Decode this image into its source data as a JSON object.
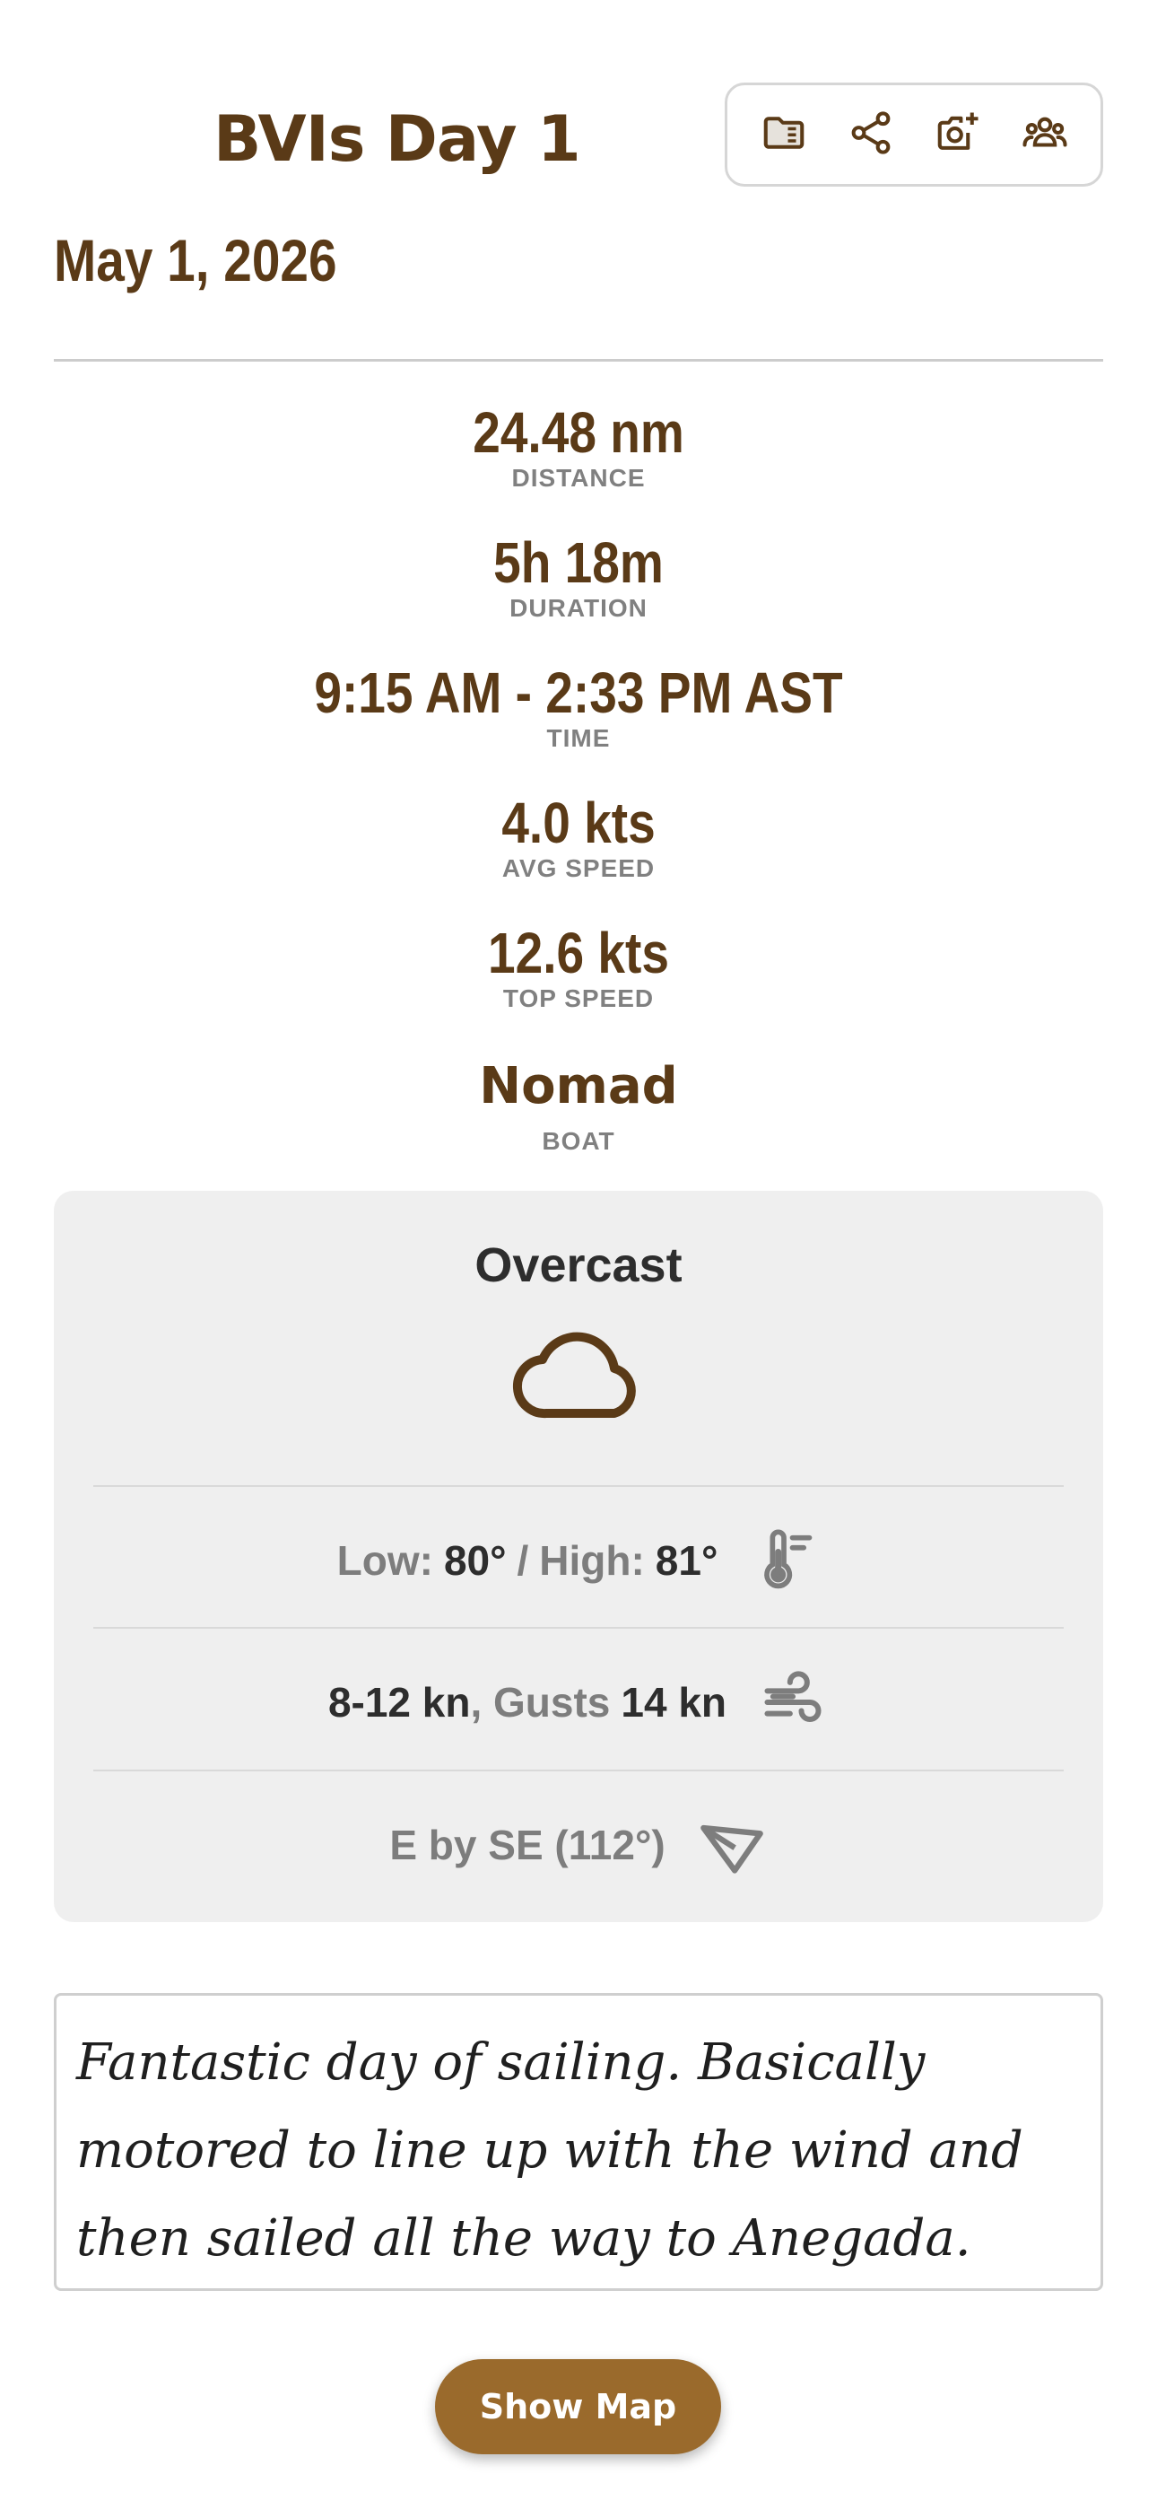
{
  "header": {
    "title": "BVIs Day 1",
    "date": "May 1, 2026"
  },
  "toolbar": {
    "buttons": [
      {
        "name": "folder",
        "icon": "folder-icon"
      },
      {
        "name": "share",
        "icon": "share-icon"
      },
      {
        "name": "add-photo",
        "icon": "add-photo-icon"
      },
      {
        "name": "crew",
        "icon": "people-icon"
      }
    ]
  },
  "stats": {
    "distance": {
      "value": "24.48 nm",
      "label": "DISTANCE"
    },
    "duration": {
      "value": "5h 18m",
      "label": "DURATION"
    },
    "time": {
      "value": "9:15 AM - 2:33 PM AST",
      "label": "TIME"
    },
    "avg_speed": {
      "value": "4.0 kts",
      "label": "AVG SPEED"
    },
    "top_speed": {
      "value": "12.6 kts",
      "label": "TOP SPEED"
    },
    "boat": {
      "value": "Nomad",
      "label": "BOAT"
    }
  },
  "weather": {
    "condition": "Overcast",
    "condition_icon": "cloud-icon",
    "temp": {
      "low_label": "Low:",
      "low_value": "80°",
      "separator": "/",
      "high_label": "High:",
      "high_value": "81°",
      "icon": "thermometer-icon"
    },
    "wind": {
      "range": "8-12 kn",
      "gusts_label": ", Gusts",
      "gusts_value": "14 kn",
      "icon": "wind-icon"
    },
    "direction": {
      "text": "E by SE (112°)",
      "icon": "direction-arrow-icon"
    }
  },
  "notes": {
    "text": "Fantastic day of sailing. Basically motored to line up with the wind and then sailed all the way to Anegada."
  },
  "actions": {
    "show_map_label": "Show Map"
  },
  "colors": {
    "brand_brown": "#5a3a17",
    "button_brown": "#9a6a2c",
    "card_gray": "#efefef",
    "label_gray": "#808080"
  }
}
